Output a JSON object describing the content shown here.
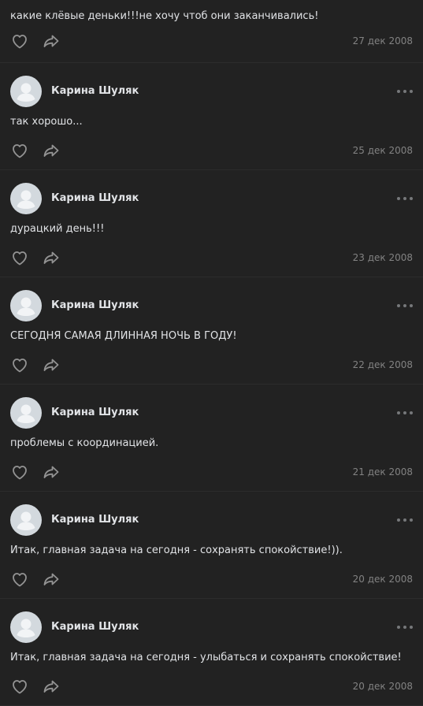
{
  "colors": {
    "background": "#222222",
    "text": "#e1e3e6",
    "muted": "#828282",
    "avatar_bg": "#d3d9de"
  },
  "first_post": {
    "text": "какие клёвые деньки!!!не хочу чтоб они заканчивались!",
    "date": "27 дек 2008"
  },
  "posts": [
    {
      "author": "Карина Шуляк",
      "text": "так хорошо...",
      "date": "25 дек 2008"
    },
    {
      "author": "Карина Шуляк",
      "text": "дурацкий день!!!",
      "date": "23 дек 2008"
    },
    {
      "author": "Карина Шуляк",
      "text": "СЕГОДНЯ САМАЯ ДЛИННАЯ НОЧЬ В ГОДУ!",
      "date": "22 дек 2008"
    },
    {
      "author": "Карина Шуляк",
      "text": "проблемы с координацией.",
      "date": "21 дек 2008"
    },
    {
      "author": "Карина Шуляк",
      "text": "Итак, главная задача на сегодня - сохранять спокойствие!)).",
      "date": "20 дек 2008"
    },
    {
      "author": "Карина Шуляк",
      "text": "Итак, главная задача на сегодня - улыбаться и сохранять спокойствие!",
      "date": "20 дек 2008"
    }
  ]
}
